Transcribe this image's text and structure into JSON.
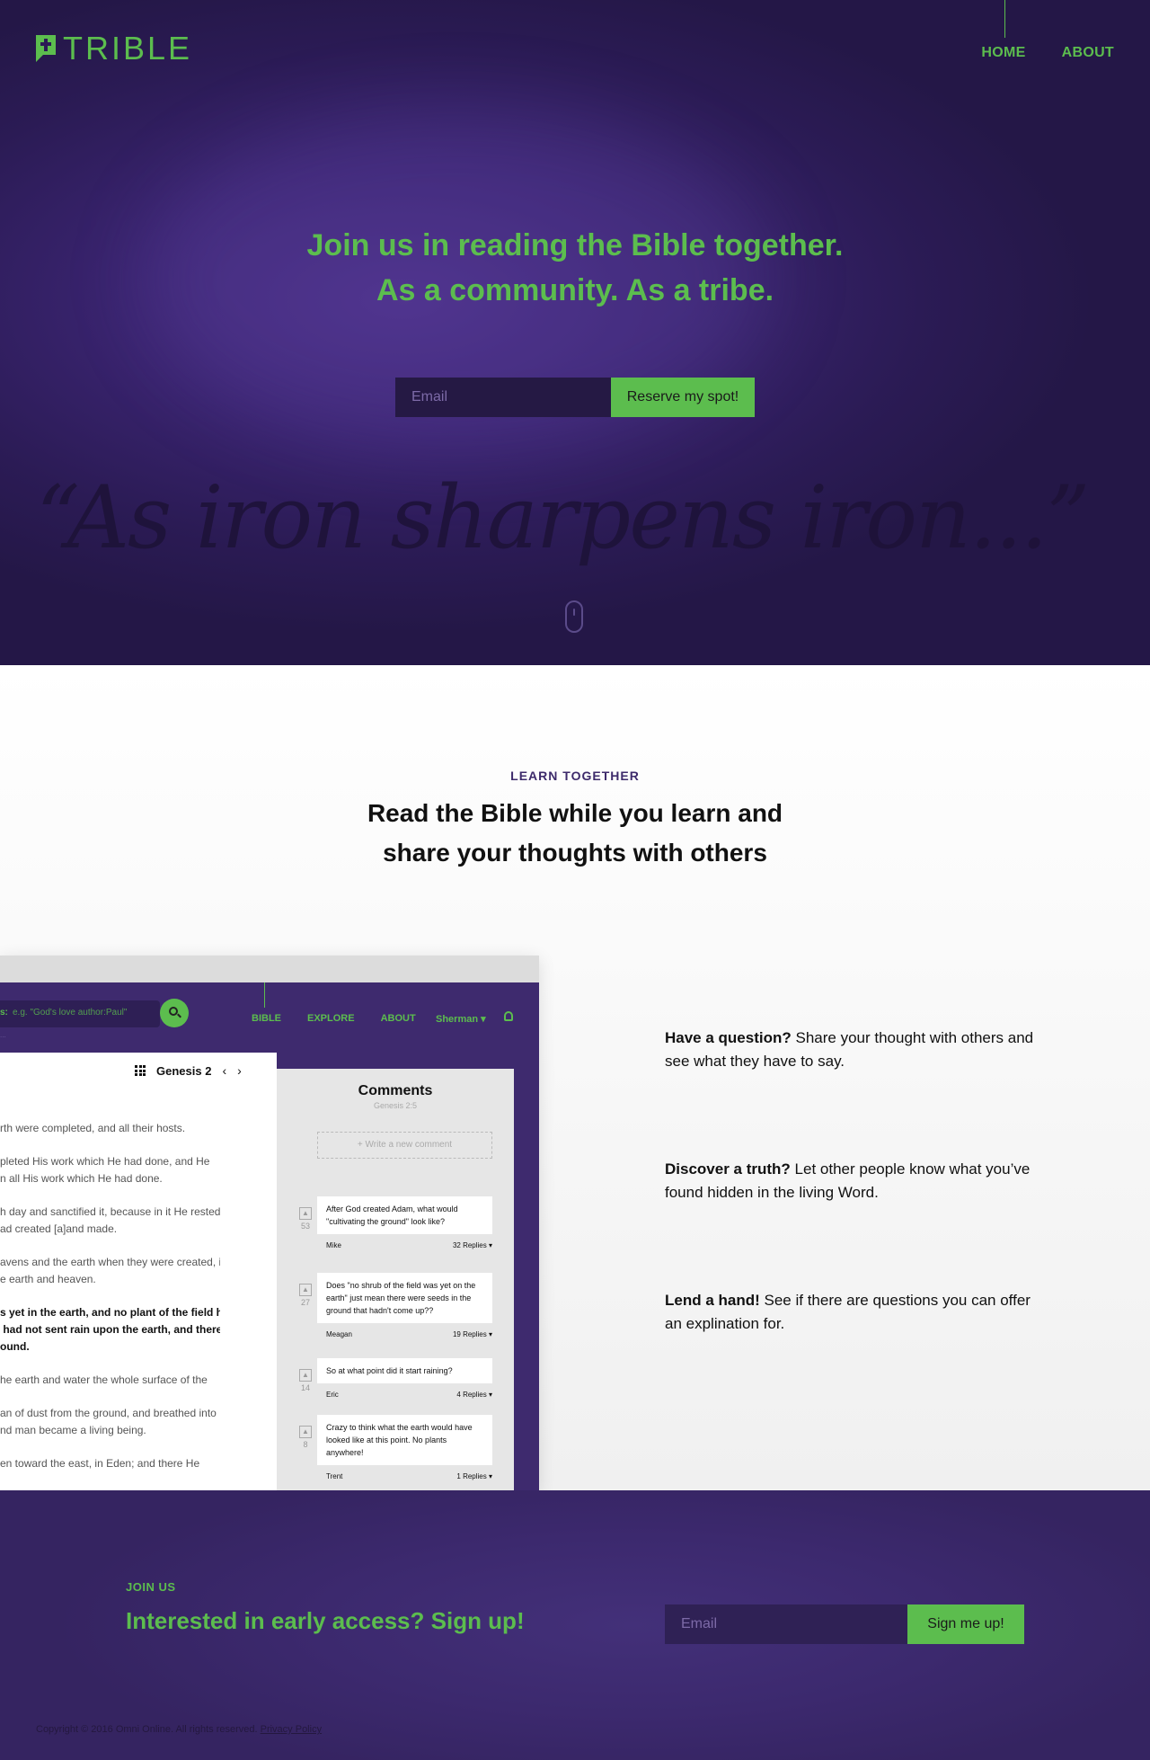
{
  "colors": {
    "accent": "#5cbd4e",
    "hero_bg": "#2b1b55",
    "brand_purple": "#3e2a6e",
    "eyebrow_purple": "#3d2a6b"
  },
  "logo": {
    "text": "TRIBLE",
    "icon": "cross-bubble-icon"
  },
  "nav": {
    "home": "HOME",
    "about": "ABOUT"
  },
  "hero": {
    "title_line1": "Join us in reading the Bible together.",
    "title_line2": "As a community.  As a tribe.",
    "email_placeholder": "Email",
    "cta": "Reserve my spot!",
    "quote": "“As iron sharpens iron...”",
    "scroll_icon": "mouse-icon"
  },
  "learn": {
    "eyebrow": "LEARN  TOGETHER",
    "title_line1": "Read the Bible while you learn and",
    "title_line2": "share your thoughts with others"
  },
  "mockup": {
    "search_label": "s:",
    "search_placeholder": "e.g. \"God's love author:Paul\"",
    "search_sub": "...",
    "nav": [
      "BIBLE",
      "EXPLORE",
      "ABOUT"
    ],
    "user": "Sherman ▾",
    "chapter": "Genesis 2",
    "verses": [
      {
        "text": "rth were completed, and all their hosts.",
        "bold": false
      },
      {
        "text": "pleted His work which He had done, and He\nn all His work which He had done.",
        "bold": false
      },
      {
        "text": "h day and sanctified it, because in it He rested\nad created [a]and made.",
        "bold": false
      },
      {
        "text": "avens and the earth when they were created, in\ne earth and heaven.",
        "bold": false
      },
      {
        "text": "s yet in the earth, and no plant of the field had\n had not sent rain upon the earth, and there\nound.",
        "bold": true
      },
      {
        "text": "he earth and water the whole surface of the",
        "bold": false
      },
      {
        "text": "an of dust from the ground, and breathed into\nnd man became a living being.",
        "bold": false
      },
      {
        "text": "en toward the east, in Eden; and there He",
        "bold": false
      }
    ],
    "comments_title": "Comments",
    "comments_ref": "Genesis 2:5",
    "new_comment": "+   Write a new comment",
    "comments": [
      {
        "text": "After God created Adam, what would \"cultivating the ground\" look like?",
        "author": "Mike",
        "replies": "32 Replies  ▾",
        "votes": "53"
      },
      {
        "text": "Does \"no shrub of the field was yet on the earth\" just mean there were seeds in the ground that hadn't come up??",
        "author": "Meagan",
        "replies": "19 Replies  ▾",
        "votes": "27"
      },
      {
        "text": "So at what point did it start raining?",
        "author": "Eric",
        "replies": "4 Replies  ▾",
        "votes": "14"
      },
      {
        "text": "Crazy to think what the earth would have looked like at this point. No plants anywhere!",
        "author": "Trent",
        "replies": "1 Replies  ▾",
        "votes": "8"
      }
    ]
  },
  "features": [
    {
      "bold": "Have a question?",
      "text": " Share your thought with others and see what they have to say."
    },
    {
      "bold": "Discover a truth?",
      "text": " Let other people know what you’ve found hidden in the living Word."
    },
    {
      "bold": "Lend a hand!",
      "text": " See if there are questions you can offer an explination for."
    }
  ],
  "join": {
    "eyebrow": "JOIN US",
    "title": "Interested in early access? Sign up!",
    "email_placeholder": "Email",
    "cta": "Sign me up!"
  },
  "footer": {
    "copyright": "Copyright © 2016 Omni Online. All rights reserved. ",
    "privacy": "Privacy Policy"
  }
}
